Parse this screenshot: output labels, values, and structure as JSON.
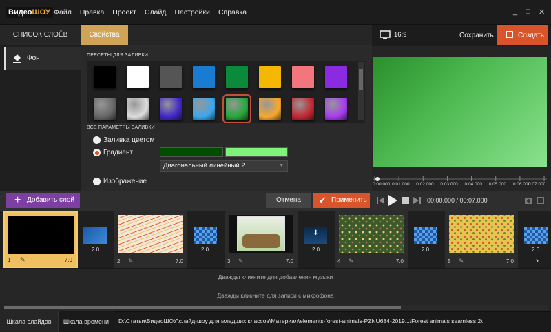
{
  "app": {
    "logo_part1": "Видео",
    "logo_part2": "ШОУ"
  },
  "menu": [
    "Файл",
    "Правка",
    "Проект",
    "Слайд",
    "Настройки",
    "Справка"
  ],
  "window_controls": {
    "minimize": "_",
    "maximize": "□",
    "close": "✕"
  },
  "tabs": {
    "layers": "СПИСОК СЛОЁВ",
    "properties": "Свойства"
  },
  "layers": [
    {
      "label": "Фон"
    }
  ],
  "fill": {
    "presets_title": "ПРЕСЕТЫ ДЛЯ ЗАЛИВКИ",
    "all_params_title": "ВСЕ ПАРАМЕТРЫ ЗАЛИВКИ",
    "presets": [
      {
        "color": "#000000"
      },
      {
        "color": "#ffffff"
      },
      {
        "color": "#555555"
      },
      {
        "color": "#1a7cd0"
      },
      {
        "color": "#0b8a3c"
      },
      {
        "color": "#f5b800"
      },
      {
        "color": "#f3767e"
      },
      {
        "color": "#8a2be2"
      },
      {
        "color": "#666"
      },
      {
        "color": "#ddd"
      },
      {
        "color": "#4026c9"
      },
      {
        "color": "#39a7f0"
      },
      {
        "color": "#24a83b"
      },
      {
        "color": "#f8a82a"
      },
      {
        "color": "#c22631"
      },
      {
        "color": "#a63cf0"
      }
    ],
    "options": {
      "solid": "Заливка цветом",
      "gradient": "Градиент",
      "image": "Изображение"
    },
    "selected_option": "gradient",
    "gradient_color1": "#004d00",
    "gradient_color2": "#7ff27a",
    "gradient_type": "Диагональный линейный 2"
  },
  "preview": {
    "aspect": "16:9",
    "save": "Сохранить",
    "create": "Создать",
    "ticks": [
      "0:00.000",
      "0:01.000",
      "0:02.000",
      "0:03.000",
      "0:04.000",
      "0:05.000",
      "0:06.000",
      "0:07.000"
    ],
    "time": "00:00.000 / 00:07.000"
  },
  "actions": {
    "add_layer": "Добавить слой",
    "cancel": "Отмена",
    "apply": "Применить"
  },
  "slides": [
    {
      "num": "1",
      "dur": "7.0"
    },
    {
      "num": "2",
      "dur": "7.0"
    },
    {
      "num": "3",
      "dur": "7.0"
    },
    {
      "num": "4",
      "dur": "7.0"
    },
    {
      "num": "5",
      "dur": "7.0"
    }
  ],
  "transitions": [
    "2.0",
    "2.0",
    "2.0",
    "2.0",
    "2.0"
  ],
  "tracks": {
    "music": "Дважды кликните для добавления музыки",
    "mic": "Дважды кликните для записи с микрофона"
  },
  "status": {
    "tab_slides": "Шкала слайдов",
    "tab_timeline": "Шкала времени",
    "path": "D:\\Статьи\\ВидеоШОУ\\слайд-шоу для младших классов\\Материал\\elements-forest-animals-PZNU684-2019...\\Forest animals seamless 2\\"
  }
}
